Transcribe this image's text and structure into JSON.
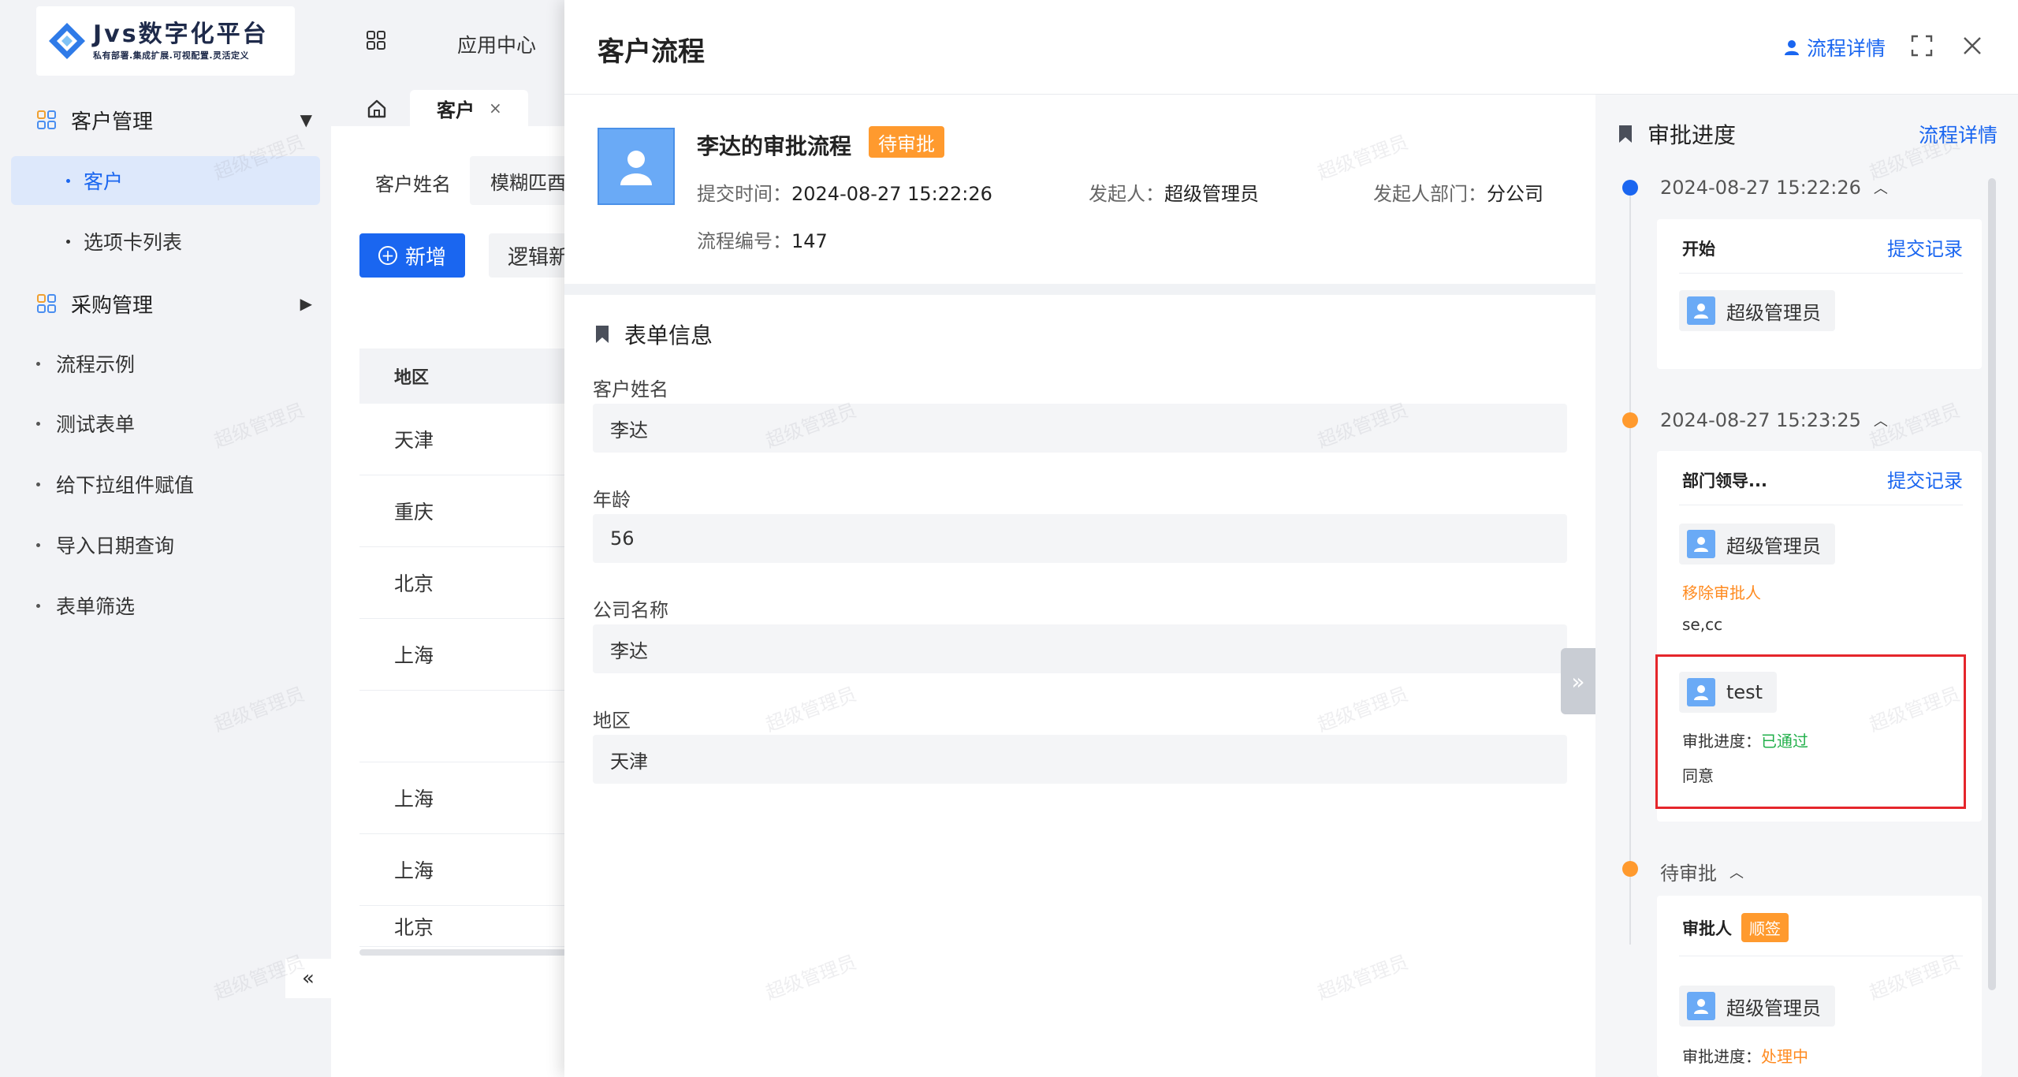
{
  "logo": {
    "title": "Jvs数字化平台",
    "subtitle": "私有部署.集成扩展.可视配置.灵活定义"
  },
  "sidebar": {
    "groups": [
      {
        "label": "客户管理"
      },
      {
        "label": "采购管理"
      }
    ],
    "sub_items": [
      {
        "label": "客户"
      },
      {
        "label": "选项卡列表"
      }
    ],
    "flat_items": [
      {
        "label": "流程示例"
      },
      {
        "label": "测试表单"
      },
      {
        "label": "给下拉组件赋值"
      },
      {
        "label": "导入日期查询"
      },
      {
        "label": "表单筛选"
      }
    ],
    "collapse_glyph": "«"
  },
  "bg_page": {
    "app_center": "应用中心",
    "tab": {
      "label": "客户",
      "close": "×"
    },
    "search": {
      "label": "客户姓名",
      "value": "模糊匹酉"
    },
    "add_button": "新增",
    "logic_button": "逻辑新",
    "table": {
      "header": "地区",
      "rows": [
        "天津",
        "重庆",
        "北京",
        "上海",
        "",
        "上海",
        "上海",
        "北京"
      ]
    }
  },
  "drawer": {
    "title": "客户流程",
    "header_link": "流程详情",
    "summary": {
      "name": "李达的审批流程",
      "badge": "待审批",
      "submit_time_label": "提交时间：",
      "submit_time": "2024-08-27 15:22:26",
      "initiator_label": "发起人：",
      "initiator": "超级管理员",
      "dept_label": "发起人部门：",
      "dept": "分公司",
      "number_label": "流程编号：",
      "number": "147"
    },
    "form": {
      "title": "表单信息",
      "fields": [
        {
          "label": "客户姓名",
          "value": "李达"
        },
        {
          "label": "年龄",
          "value": "56"
        },
        {
          "label": "公司名称",
          "value": "李达"
        },
        {
          "label": "地区",
          "value": "天津"
        }
      ]
    },
    "expand_glyph": "»",
    "progress": {
      "title": "审批进度",
      "link": "流程详情",
      "nodes": [
        {
          "time": "2024-08-27 15:22:26",
          "title": "开始",
          "link": "提交记录",
          "user": "超级管理员"
        },
        {
          "time": "2024-08-27 15:23:25",
          "title": "部门领导...",
          "link": "提交记录",
          "user": "超级管理员",
          "remove_label": "移除审批人",
          "remove_value": "se,cc",
          "sub_user": "test",
          "sub_status_label": "审批进度：",
          "sub_status": "已通过",
          "sub_comment": "同意"
        },
        {
          "time": "待审批",
          "title": "审批人",
          "badge": "顺签",
          "user": "超级管理员",
          "status_label": "审批进度：",
          "status": "处理中"
        }
      ]
    }
  },
  "watermark": "超级管理员",
  "colors": {
    "primary": "#1a66f0",
    "pending_orange": "#ff9a2e",
    "approved_green": "#22b04b",
    "highlight_red": "#e5262b"
  }
}
